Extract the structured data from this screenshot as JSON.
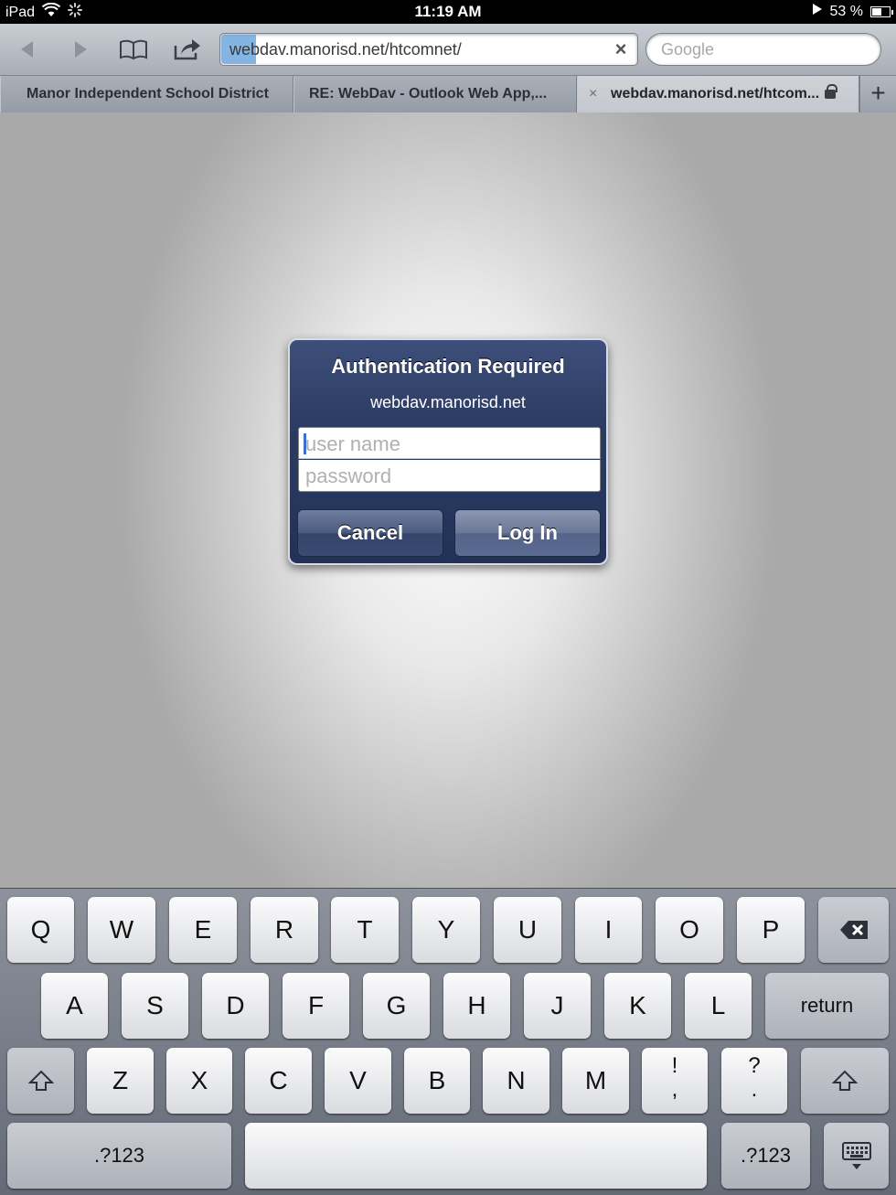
{
  "status_bar": {
    "device": "iPad",
    "time": "11:19 AM",
    "battery_percent": "53 %",
    "battery_level": 0.53
  },
  "toolbar": {
    "url": "webdav.manorisd.net/htcomnet/",
    "search_placeholder": "Google",
    "icons": [
      "back-arrow-icon",
      "forward-arrow-icon",
      "bookmarks-book-icon",
      "share-arrow-icon",
      "clear-x-icon"
    ]
  },
  "tabs": [
    {
      "label": "Manor Independent School District",
      "active": false
    },
    {
      "label": "RE: WebDav - Outlook Web App,...",
      "active": false
    },
    {
      "label": "webdav.manorisd.net/htcom...",
      "active": true,
      "close": "×"
    }
  ],
  "tab_add_label": "+",
  "dialog": {
    "title": "Authentication Required",
    "host": "webdav.manorisd.net",
    "username_placeholder": "user name",
    "password_placeholder": "password",
    "cancel_label": "Cancel",
    "login_label": "Log In"
  },
  "keyboard": {
    "row1": [
      "Q",
      "W",
      "E",
      "R",
      "T",
      "Y",
      "U",
      "I",
      "O",
      "P"
    ],
    "row2": [
      "A",
      "S",
      "D",
      "F",
      "G",
      "H",
      "J",
      "K",
      "L"
    ],
    "row3": [
      "Z",
      "X",
      "C",
      "V",
      "B",
      "N",
      "M"
    ],
    "return_label": "return",
    "numbers_label": ".?123",
    "punct1_top": "!",
    "punct1_bottom": ",",
    "punct2_top": "?",
    "punct2_bottom": "."
  }
}
